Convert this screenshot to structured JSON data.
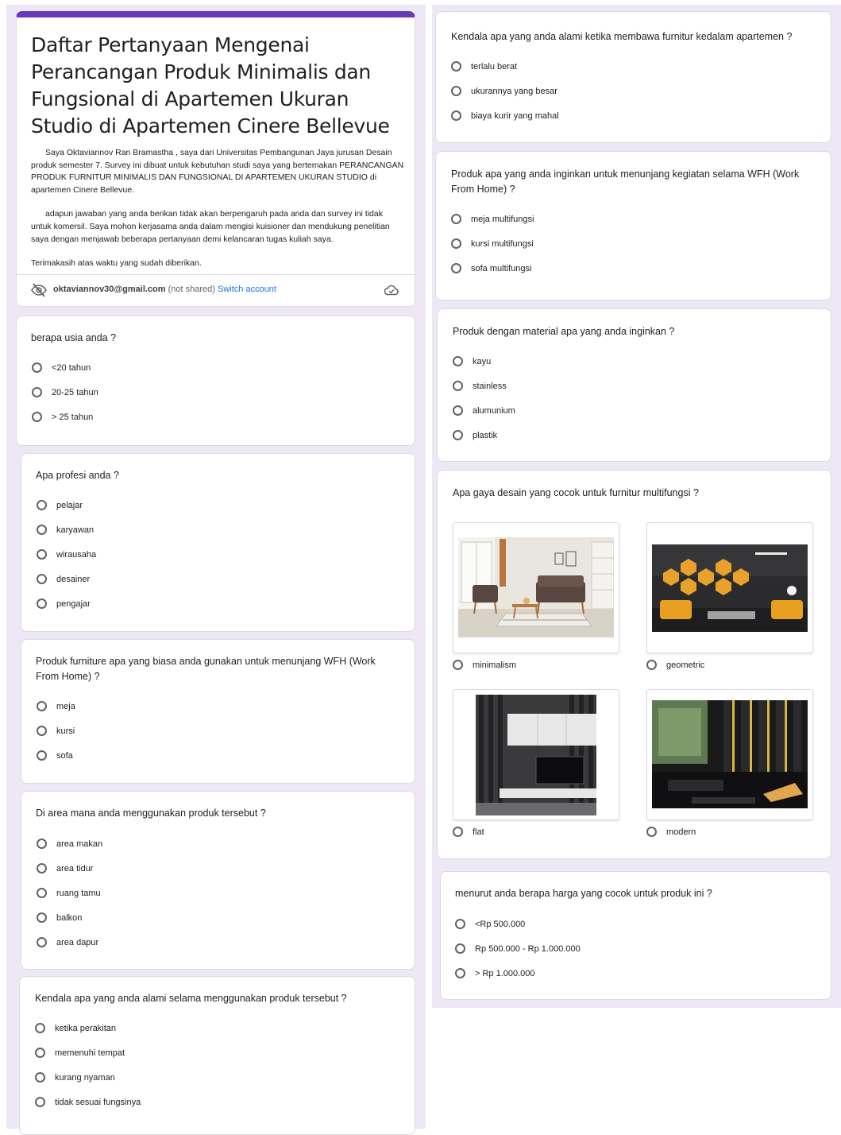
{
  "form": {
    "title": "Daftar Pertanyaan Mengenai Perancangan Produk Minimalis dan Fungsional di Apartemen Ukuran Studio di Apartemen Cinere Bellevue",
    "description": [
      "Saya Oktaviannov Ran Bramastha , saya dari Universitas Pembangunan Jaya jurusan Desain produk semester 7. Survey ini dibuat untuk kebutuhan studi saya yang bertemakan PERANCANGAN PRODUK FURNITUR MINIMALIS DAN FUNGSIONAL DI APARTEMEN UKURAN STUDIO di apartemen Cinere Bellevue.",
      "adapun jawaban yang anda berikan tidak akan berpengaruh pada anda dan survey ini tidak untuk komersil. Saya mohon kerjasama anda dalam mengisi kuisioner dan mendukung penelitian saya dengan menjawab beberapa pertanyaan demi kelancaran tugas kuliah saya.",
      "Terimakasih atas waktu yang sudah diberikan."
    ],
    "account": {
      "email": "oktaviannov30@gmail.com",
      "not_shared": "(not shared)",
      "switch": "Switch account"
    }
  },
  "questions": {
    "age": {
      "title": "berapa usia anda ?",
      "options": [
        "<20 tahun",
        "20-25 tahun",
        "> 25 tahun"
      ]
    },
    "profession": {
      "title": "Apa profesi anda ?",
      "options": [
        "pelajar",
        "karyawan",
        "wirausaha",
        "desainer",
        "pengajar"
      ]
    },
    "furniture_used": {
      "title": "Produk furniture apa yang biasa anda gunakan untuk menunjang WFH (Work From Home) ?",
      "options": [
        "meja",
        "kursi",
        "sofa"
      ]
    },
    "area": {
      "title": "Di area mana anda menggunakan produk tersebut ?",
      "options": [
        "area makan",
        "area tidur",
        "ruang tamu",
        "balkon",
        "area dapur"
      ]
    },
    "problem_use": {
      "title": "Kendala apa yang anda alami selama menggunakan produk tersebut ?",
      "options": [
        "ketika perakitan",
        "memenuhi tempat",
        "kurang nyaman",
        "tidak sesuai fungsinya"
      ]
    },
    "problem_bring": {
      "title": "Kendala apa yang anda alami ketika membawa furnitur kedalam apartemen ?",
      "options": [
        "terlalu berat",
        "ukurannya yang besar",
        "biaya kurir yang mahal"
      ]
    },
    "product_wanted": {
      "title": "Produk apa yang anda inginkan untuk menunjang kegiatan selama WFH (Work From Home) ?",
      "options": [
        "meja multifungsi",
        "kursi multifungsi",
        "sofa multifungsi"
      ]
    },
    "material": {
      "title": "Produk dengan material apa yang anda inginkan ?",
      "options": [
        "kayu",
        "stainless",
        "alumunium",
        "plastik"
      ]
    },
    "style": {
      "title": "Apa gaya desain yang cocok untuk furnitur multifungsi ?",
      "options": [
        "minimalism",
        "geometric",
        "flat",
        "modern"
      ]
    },
    "price": {
      "title": "menurut anda berapa harga yang cocok untuk produk ini ?",
      "options": [
        "<Rp 500.000",
        "Rp 500.000 - Rp 1.000.000",
        "> Rp 1.000.000"
      ]
    }
  },
  "colors": {
    "accent": "#673ab7",
    "background": "#ede7f6",
    "link": "#1a73e8"
  },
  "icons": {
    "account_hidden": "eye-off-icon",
    "cloud": "cloud-check-icon"
  }
}
